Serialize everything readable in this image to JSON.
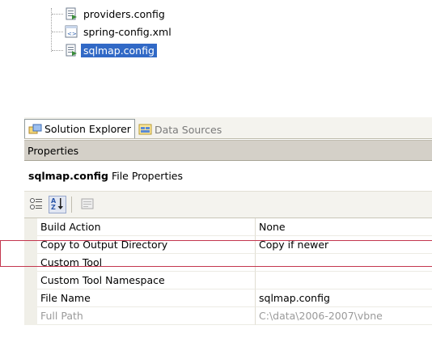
{
  "tree": {
    "items": [
      {
        "label": "providers.config",
        "icon": "config-file-icon",
        "selected": false
      },
      {
        "label": "spring-config.xml",
        "icon": "xml-file-icon",
        "selected": false
      },
      {
        "label": "sqlmap.config",
        "icon": "config-file-icon",
        "selected": true
      }
    ]
  },
  "tabs": [
    {
      "label": "Solution Explorer",
      "icon": "solution-explorer-icon",
      "active": true
    },
    {
      "label": "Data Sources",
      "icon": "data-sources-icon",
      "active": false
    }
  ],
  "properties": {
    "title": "Properties",
    "object_name": "sqlmap.config",
    "object_type": "File Properties",
    "toolbar": [
      "categorized-icon",
      "alphabetical-icon",
      "property-pages-icon"
    ],
    "rows": [
      {
        "name": "Build Action",
        "value": "None",
        "readonly": false
      },
      {
        "name": "Copy to Output Directory",
        "value": "Copy if newer",
        "readonly": false
      },
      {
        "name": "Custom Tool",
        "value": "",
        "readonly": false
      },
      {
        "name": "Custom Tool Namespace",
        "value": "",
        "readonly": false
      },
      {
        "name": "File Name",
        "value": "sqlmap.config",
        "readonly": false
      },
      {
        "name": "Full Path",
        "value": "C:\\data\\2006-2007\\vbne",
        "readonly": true
      }
    ]
  },
  "colors": {
    "selection": "#3169c6",
    "highlight_outline": "#c3374f"
  }
}
